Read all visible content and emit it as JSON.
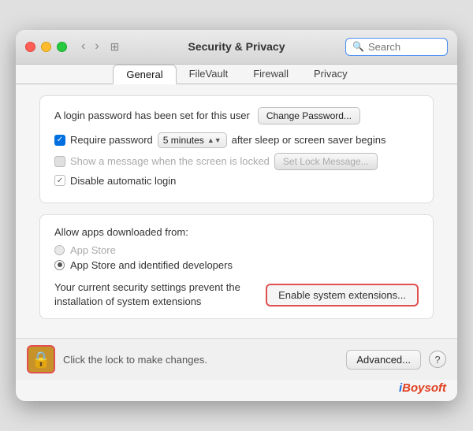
{
  "window": {
    "title": "Security & Privacy",
    "search_placeholder": "Search"
  },
  "tabs": [
    {
      "label": "General",
      "active": true
    },
    {
      "label": "FileVault",
      "active": false
    },
    {
      "label": "Firewall",
      "active": false
    },
    {
      "label": "Privacy",
      "active": false
    }
  ],
  "general": {
    "login_text": "A login password has been set for this user",
    "change_password_label": "Change Password...",
    "require_password_label": "Require password",
    "require_password_interval": "5 minutes",
    "after_label": "after sleep or screen saver begins",
    "show_message_label": "Show a message when the screen is locked",
    "set_lock_message_label": "Set Lock Message...",
    "disable_autologin_label": "Disable automatic login",
    "allow_apps_label": "Allow apps downloaded from:",
    "app_store_label": "App Store",
    "app_store_identified_label": "App Store and identified developers",
    "extensions_text": "Your current security settings prevent the installation of system extensions",
    "enable_extensions_label": "Enable system extensions...",
    "lock_text": "Click the lock to make changes.",
    "advanced_label": "Advanced...",
    "help_label": "?"
  },
  "brand": {
    "prefix": "i",
    "rest": "Boysoft"
  }
}
